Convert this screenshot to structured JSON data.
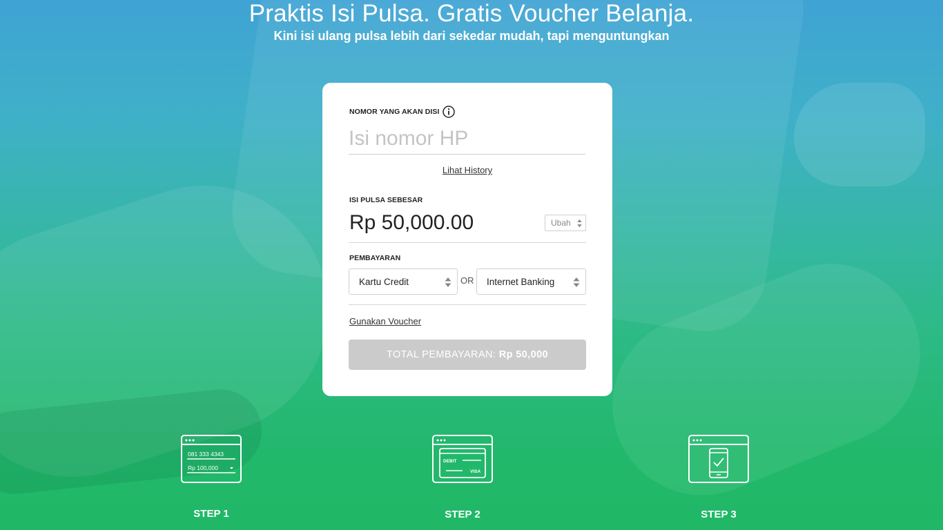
{
  "hero": {
    "title": "Praktis Isi Pulsa. Gratis Voucher Belanja.",
    "subtitle": "Kini isi ulang pulsa lebih dari sekedar mudah, tapi menguntungkan"
  },
  "form": {
    "number_label": "NOMOR YANG AKAN DISI",
    "number_placeholder": "Isi nomor HP",
    "number_value": "",
    "history_link": "Lihat History",
    "amount_label": "ISI PULSA SEBESAR",
    "amount_value": "Rp 50,000.00",
    "change_button": "Ubah",
    "payment_label": "PEMBAYARAN",
    "payment_option_1": "Kartu Credit",
    "or_text": "OR",
    "payment_option_2": "Internet Banking",
    "voucher_link": "Gunakan Voucher",
    "total_label": "TOTAL  PEMBAYARAN:",
    "total_value": "Rp 50,000"
  },
  "steps": [
    {
      "label": "STEP 1",
      "icon": "phone-form-icon",
      "example_number": "081 333 4343",
      "example_amount": "Rp 100,000"
    },
    {
      "label": "STEP 2",
      "icon": "debit-card-icon",
      "card_text": "DEBIT",
      "card_brand": "VISA"
    },
    {
      "label": "STEP 3",
      "icon": "phone-check-icon"
    }
  ],
  "colors": {
    "top": "#3fa3d4",
    "bottom": "#20b866",
    "button_disabled": "#cbcbcb"
  }
}
